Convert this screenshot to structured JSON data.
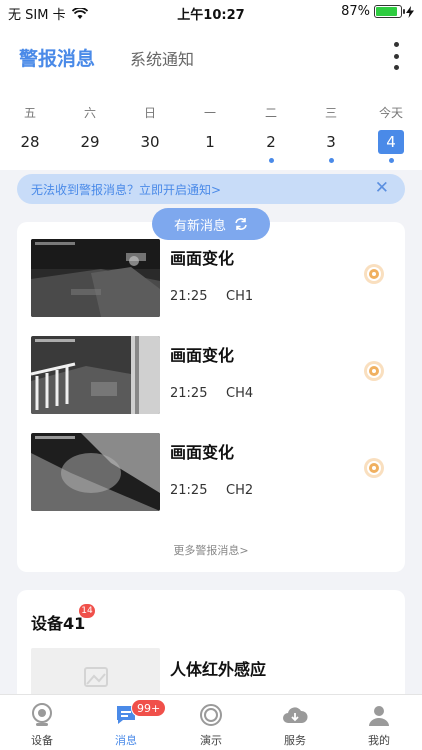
{
  "status_bar": {
    "carrier": "无 SIM 卡",
    "time": "上午10:27",
    "battery": "87%",
    "battery_level": 0.87
  },
  "header": {
    "tab_alarm": "警报消息",
    "tab_system": "系统通知"
  },
  "calendar": {
    "days": [
      {
        "weekday": "五",
        "date": "28",
        "has_events": false
      },
      {
        "weekday": "六",
        "date": "29",
        "has_events": false
      },
      {
        "weekday": "日",
        "date": "30",
        "has_events": false
      },
      {
        "weekday": "一",
        "date": "1",
        "has_events": false
      },
      {
        "weekday": "二",
        "date": "2",
        "has_events": true
      },
      {
        "weekday": "三",
        "date": "3",
        "has_events": true
      },
      {
        "weekday": "今天",
        "date": "4",
        "has_events": true,
        "selected": true
      }
    ]
  },
  "notice": {
    "text": "无法收到警报消息？立即开启通知>"
  },
  "new_messages": {
    "label": "有新消息"
  },
  "alarms": {
    "items": [
      {
        "title": "画面变化",
        "time": "21:25",
        "channel": "CH1"
      },
      {
        "title": "画面变化",
        "time": "21:25",
        "channel": "CH4"
      },
      {
        "title": "画面变化",
        "time": "21:25",
        "channel": "CH2"
      }
    ],
    "more_label": "更多警报消息>"
  },
  "devices": {
    "title": "设备41",
    "badge": "14",
    "first_item": "人体红外感应"
  },
  "nav": {
    "items": [
      {
        "label": "设备"
      },
      {
        "label": "消息",
        "badge": "99+"
      },
      {
        "label": "演示"
      },
      {
        "label": "服务"
      },
      {
        "label": "我的"
      }
    ]
  },
  "colors": {
    "accent": "#4a8ae8",
    "badge": "#f0504a",
    "alarm_icon": "#f0b060"
  }
}
